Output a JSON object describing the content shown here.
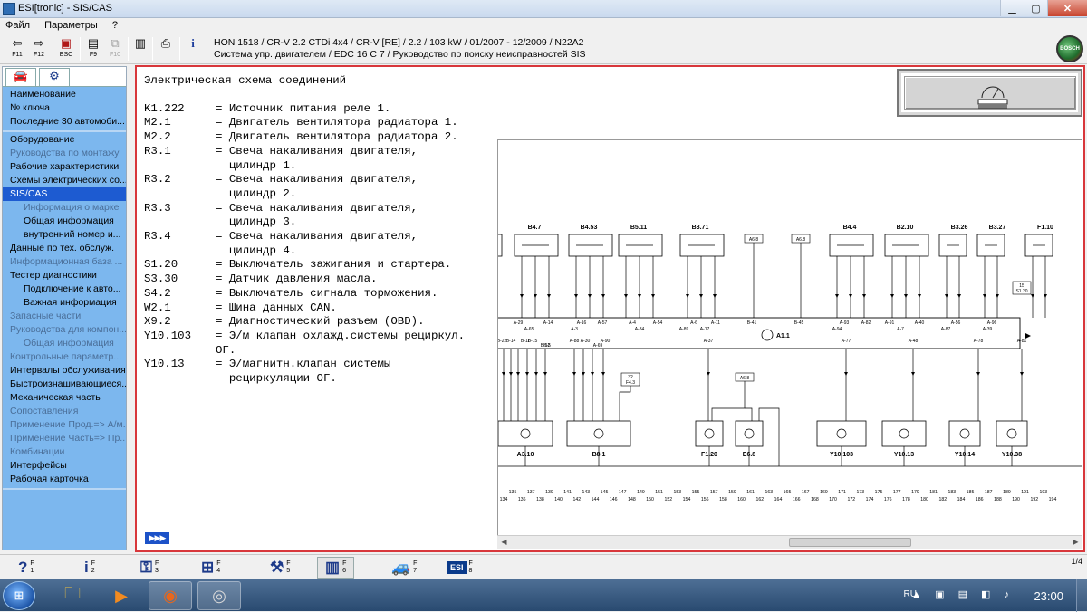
{
  "window": {
    "title": "ESI[tronic] - SIS/CAS",
    "min_label": "▁",
    "max_label": "▢",
    "close_label": "✕"
  },
  "menu": [
    "Файл",
    "Параметры",
    "?"
  ],
  "toolbar": {
    "buttons": [
      {
        "icon": "back-arrow-icon",
        "glyph": "⇦",
        "label": "F11"
      },
      {
        "icon": "forward-arrow-icon",
        "glyph": "⇨",
        "label": "F12"
      },
      {
        "icon": "escape-icon",
        "glyph": "▣",
        "label": "ESC"
      },
      {
        "icon": "document-list-icon",
        "glyph": "▤",
        "label": "F9"
      },
      {
        "icon": "network-icon",
        "glyph": "⧉",
        "label": "F10"
      },
      {
        "icon": "document-icon",
        "glyph": "▥",
        "label": ""
      },
      {
        "icon": "printer-icon",
        "glyph": "⎙",
        "label": ""
      },
      {
        "icon": "info-icon",
        "glyph": "i",
        "label": ""
      }
    ],
    "vehicle_line1": "HON 1518 / CR-V 2.2 CTDi 4x4 / CR-V [RE] / 2.2 / 103 kW / 01/2007 - 12/2009 / N22A2",
    "vehicle_line2": "Система упр. двигателем / EDC 16 C 7 / Руководство по поиску неисправностей SIS",
    "logo_text": "BOSCH"
  },
  "sidebar": {
    "tabs": [
      {
        "icon": "car-icon",
        "glyph": "🚘"
      },
      {
        "icon": "engine-icon",
        "glyph": "⚙"
      }
    ],
    "groups": [
      [
        {
          "label": "Наименование",
          "state": "normal",
          "indent": 0
        },
        {
          "label": "№ ключа",
          "state": "normal",
          "indent": 0
        },
        {
          "label": "Последние 30 автомоби...",
          "state": "normal",
          "indent": 0
        }
      ],
      [
        {
          "label": "Оборудование",
          "state": "normal",
          "indent": 0
        },
        {
          "label": "Руководства по монтажу",
          "state": "dim",
          "indent": 0
        },
        {
          "label": "Рабочие характеристики",
          "state": "normal",
          "indent": 0
        },
        {
          "label": "Схемы электрических со...",
          "state": "normal",
          "indent": 0
        },
        {
          "label": "SIS/CAS",
          "state": "selected",
          "indent": 0
        },
        {
          "label": "Информация о марке",
          "state": "dim",
          "indent": 1
        },
        {
          "label": "Общая информация",
          "state": "normal",
          "indent": 1
        },
        {
          "label": "внутренний номер и...",
          "state": "normal",
          "indent": 1
        },
        {
          "label": "Данные по тех. обслуж.",
          "state": "normal",
          "indent": 0
        },
        {
          "label": "Информационная база ...",
          "state": "dim",
          "indent": 0
        },
        {
          "label": "Тестер диагностики",
          "state": "normal",
          "indent": 0
        },
        {
          "label": "Подключение к авто...",
          "state": "normal",
          "indent": 1
        },
        {
          "label": "Важная информация",
          "state": "normal",
          "indent": 1
        },
        {
          "label": "Запасные части",
          "state": "dim",
          "indent": 0
        },
        {
          "label": "Руководства для компон...",
          "state": "dim",
          "indent": 0
        },
        {
          "label": "Общая информация",
          "state": "dim",
          "indent": 1
        },
        {
          "label": "Контрольные параметр...",
          "state": "dim",
          "indent": 0
        },
        {
          "label": "Интервалы обслуживания",
          "state": "normal",
          "indent": 0
        },
        {
          "label": "Быстроизнашивающиеся...",
          "state": "normal",
          "indent": 0
        },
        {
          "label": "Механическая часть",
          "state": "normal",
          "indent": 0
        },
        {
          "label": "Сопоставления",
          "state": "dim",
          "indent": 0
        },
        {
          "label": "Применение Прод.=> А/м.",
          "state": "dim",
          "indent": 0
        },
        {
          "label": "Применение Часть=> Пр...",
          "state": "dim",
          "indent": 0
        },
        {
          "label": "Комбинации",
          "state": "dim",
          "indent": 0
        },
        {
          "label": "Интерфейсы",
          "state": "normal",
          "indent": 0
        },
        {
          "label": "Рабочая карточка",
          "state": "normal",
          "indent": 0
        }
      ]
    ]
  },
  "content": {
    "heading": "Электрическая схема соединений",
    "entries": [
      {
        "code": "K1.222",
        "desc": "= Источник питания реле 1."
      },
      {
        "code": "M2.1",
        "desc": "= Двигатель вентилятора радиатора 1."
      },
      {
        "code": "M2.2",
        "desc": "= Двигатель вентилятора радиатора 2."
      },
      {
        "code": "R3.1",
        "desc": "= Свеча накаливания двигателя,\n  цилиндр 1."
      },
      {
        "code": "R3.2",
        "desc": "= Свеча накаливания двигателя,\n  цилиндр 2."
      },
      {
        "code": "R3.3",
        "desc": "= Свеча накаливания двигателя,\n  цилиндр 3."
      },
      {
        "code": "R3.4",
        "desc": "= Свеча накаливания двигателя,\n  цилиндр 4."
      },
      {
        "code": "S1.20",
        "desc": "= Выключатель зажигания и стартера."
      },
      {
        "code": "S3.30",
        "desc": "= Датчик давления масла."
      },
      {
        "code": "S4.2",
        "desc": "= Выключатель сигнала торможения."
      },
      {
        "code": "W2.1",
        "desc": "= Шина данных CAN."
      },
      {
        "code": "X9.2",
        "desc": "= Диагностический разъем (OBD)."
      },
      {
        "code": "Y10.103",
        "desc": "= Э/м клапан охлажд.системы рециркул.\nОГ."
      },
      {
        "code": "Y10.13",
        "desc": "= Э/магнитн.клапан системы\n  рециркуляции ОГ."
      }
    ],
    "nav_arrow": "▶▶▶"
  },
  "schematic": {
    "top_components": [
      "B4.7",
      "B4.53",
      "B5.11",
      "B3.71",
      "B4.4",
      "B2.10",
      "B3.26",
      "B3.27",
      "F1.10"
    ],
    "ref_boxes": [
      "A6.8",
      "A6.8"
    ],
    "ecu_label": "A1.1",
    "top_pins": [
      "A-29",
      "A-14",
      "A-16",
      "A-57",
      "A-4",
      "A-54",
      "A-6",
      "A-11",
      "B-41",
      "B-45",
      "A-93",
      "A-82",
      "A-91",
      "A-40",
      "A-56",
      "A-96"
    ],
    "top_pins2": [
      "A-65",
      "A-3",
      "A-84",
      "A-89",
      "A-17",
      "A-94",
      "A-7",
      "A-87",
      "A-39"
    ],
    "bottom_pins": [
      "B-22",
      "B-14",
      "B-11",
      "B-15",
      "B-12",
      "B-5",
      "A-88",
      "A-30",
      "A-90",
      "A-69",
      "A-37",
      "A-77",
      "A-48",
      "A-78",
      "A-81"
    ],
    "fuse_ref": "32",
    "fuse_ref2": "F4.3",
    "s120_ref": "15",
    "s120_ref2": "S1.20",
    "lower_ref": "A6.8",
    "bottom_components": [
      "A3.10",
      "B8.1",
      "F1.20",
      "E6.8",
      "Y10.103",
      "Y10.13",
      "Y10.14",
      "Y10.38"
    ],
    "ruler_top": [
      "135",
      "137",
      "139",
      "141",
      "143",
      "145",
      "147",
      "149",
      "151",
      "153",
      "155",
      "157",
      "159",
      "161",
      "163",
      "165",
      "167",
      "169",
      "171",
      "173",
      "175",
      "177",
      "179",
      "181",
      "183",
      "185",
      "187",
      "189",
      "191",
      "193"
    ],
    "ruler_bottom": [
      "134",
      "136",
      "138",
      "140",
      "142",
      "144",
      "146",
      "148",
      "150",
      "152",
      "154",
      "156",
      "158",
      "160",
      "162",
      "164",
      "166",
      "168",
      "170",
      "172",
      "174",
      "176",
      "178",
      "180",
      "182",
      "184",
      "186",
      "188",
      "190",
      "192",
      "194"
    ]
  },
  "fkeys": [
    {
      "icon": "help-icon",
      "glyph": "?",
      "key": "F\n1"
    },
    {
      "icon": "info-icon",
      "glyph": "i",
      "key": "F\n2"
    },
    {
      "icon": "schematic-icon",
      "glyph": "⚿",
      "key": "F\n3"
    },
    {
      "icon": "diagram-icon",
      "glyph": "⊞",
      "key": "F\n4"
    },
    {
      "icon": "tools-icon",
      "glyph": "⚒",
      "key": "F\n5"
    },
    {
      "icon": "gauge-icon",
      "glyph": "▥",
      "key": "F\n6"
    },
    {
      "icon": "vehicle-icon",
      "glyph": "🚙",
      "key": "F\n7"
    },
    {
      "icon": "esi-kts-icon",
      "glyph": "ESI",
      "key": "F\n8"
    }
  ],
  "page_count": "1/4",
  "taskbar": {
    "apps": [
      {
        "icon": "file-explorer-icon",
        "glyph": "🗀"
      },
      {
        "icon": "media-player-icon",
        "glyph": "▶"
      },
      {
        "icon": "firefox-icon",
        "glyph": "◉"
      },
      {
        "icon": "disc-icon",
        "glyph": "◎"
      }
    ],
    "language": "RU",
    "tray_icons": "▲ ▣ ▤ ◧ ♪",
    "clock": "23:00"
  }
}
